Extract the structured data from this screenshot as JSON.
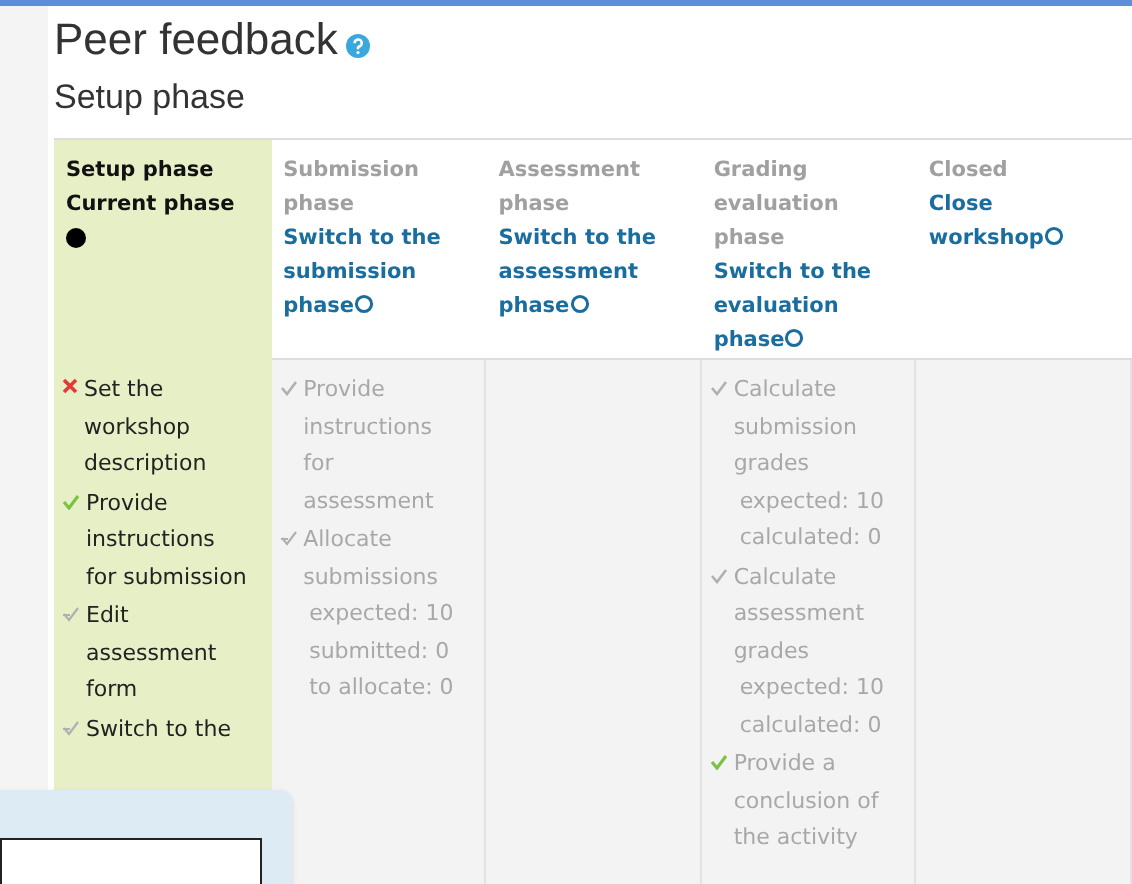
{
  "title": "Peer feedback",
  "subtitle": "Setup phase",
  "phases": [
    {
      "title": "Setup phase",
      "current": true,
      "current_label": "Current phase",
      "tasks": [
        {
          "kind": "fail",
          "text": "Set the workshop description"
        },
        {
          "kind": "done",
          "text": "Provide instructions for submission"
        },
        {
          "kind": "info",
          "text": "Edit assessment form"
        },
        {
          "kind": "info",
          "text": "Switch to the"
        }
      ]
    },
    {
      "title": "Submission phase",
      "current": false,
      "action": "Switch to the submission phase",
      "tasks": [
        {
          "kind": "todo",
          "text": "Provide instructions for assessment"
        },
        {
          "kind": "info",
          "text": "Allocate submissions",
          "details": [
            "expected: 10",
            "submitted: 0",
            "to allocate: 0"
          ]
        }
      ]
    },
    {
      "title": "Assessment phase",
      "current": false,
      "action": "Switch to the assessment phase"
    },
    {
      "title": "Grading evaluation phase",
      "current": false,
      "action": "Switch to the evaluation phase",
      "tasks": [
        {
          "kind": "todo",
          "text": "Calculate submission grades",
          "details": [
            "expected: 10",
            "calculated: 0"
          ]
        },
        {
          "kind": "todo",
          "text": "Calculate assessment grades",
          "details": [
            "expected: 10",
            "calculated: 0"
          ]
        },
        {
          "kind": "done",
          "text": "Provide a conclusion of the activity"
        }
      ]
    },
    {
      "title": "Closed",
      "current": false,
      "action": "Close workshop"
    }
  ]
}
